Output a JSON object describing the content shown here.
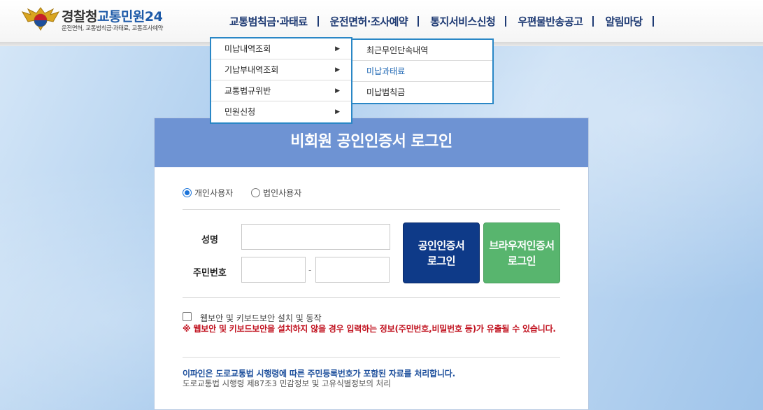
{
  "header": {
    "logo_title_main": "경찰청",
    "logo_title_accent": "교통민원24",
    "logo_subtitle": "운전면허, 교통범칙금·과태료, 교통조사예약"
  },
  "gnb": [
    {
      "label": "교통범칙금·과태료"
    },
    {
      "label": "운전면허·조사예약"
    },
    {
      "label": "통지서비스신청"
    },
    {
      "label": "우편물반송공고"
    },
    {
      "label": "알림마당"
    }
  ],
  "dropdown": [
    {
      "label": "미납내역조회"
    },
    {
      "label": "기납부내역조회"
    },
    {
      "label": "교통법규위반"
    },
    {
      "label": "민원신청"
    }
  ],
  "submenu": [
    {
      "label": "최근무인단속내역"
    },
    {
      "label": "미납과태료"
    },
    {
      "label": "미납범칙금"
    }
  ],
  "panel": {
    "title": "비회원 공인인증서 로그인",
    "radio_personal": "개인사용자",
    "radio_corporate": "법인사용자",
    "label_name": "성명",
    "label_rrn": "주민번호",
    "rrn_separator": "-",
    "btn_cert": "공인인증서\n로그인",
    "btn_browser": "브라우저인증서\n로그인",
    "checkbox_label": "웹보안 및 키보드보안 설치 및 동작",
    "warning": "※ 웹보안 및 키보드보안을 설치하지 않을 경우 입력하는 정보(주민번호,비밀번호 등)가 유출될 수 있습니다.",
    "notice_main": "이파인은 도로교통법 시행령에 따른 주민등록번호가 포함된 자료를 처리합니다.",
    "notice_sub": "도로교통법 시행령 제87조3 민감정보 및 고유식별정보의 처리"
  },
  "colors": {
    "nav_text": "#1f3b74",
    "panel_header": "#6e93d3",
    "cert_button": "#0e3a88",
    "browser_button": "#58b56e",
    "warning_text": "#c1121f",
    "menu_border": "#2a87c6"
  }
}
